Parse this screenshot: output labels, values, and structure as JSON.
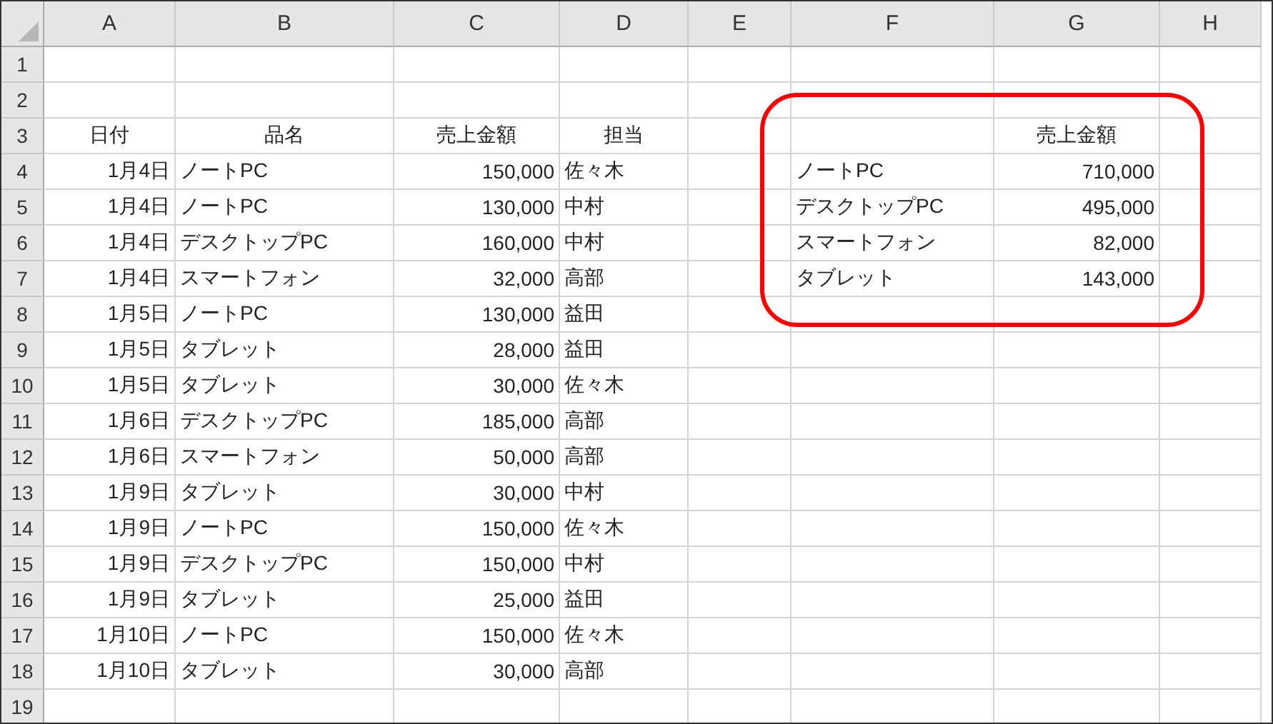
{
  "columns": [
    "A",
    "B",
    "C",
    "D",
    "E",
    "F",
    "G",
    "H"
  ],
  "rows": [
    {
      "number": "1",
      "kind": "data",
      "cells": {}
    },
    {
      "number": "2",
      "kind": "data",
      "cells": {}
    },
    {
      "number": "3",
      "kind": "header",
      "cells": {
        "A": "日付",
        "B": "品名",
        "C": "売上金額",
        "D": "担当",
        "G": "売上金額"
      }
    },
    {
      "number": "4",
      "kind": "data",
      "cells": {
        "A": "1月4日",
        "B": "ノートPC",
        "C": "150,000",
        "D": "佐々木",
        "F": "ノートPC",
        "G": "710,000"
      }
    },
    {
      "number": "5",
      "kind": "data",
      "cells": {
        "A": "1月4日",
        "B": "ノートPC",
        "C": "130,000",
        "D": "中村",
        "F": "デスクトップPC",
        "G": "495,000"
      }
    },
    {
      "number": "6",
      "kind": "data",
      "cells": {
        "A": "1月4日",
        "B": "デスクトップPC",
        "C": "160,000",
        "D": "中村",
        "F": "スマートフォン",
        "G": "82,000"
      }
    },
    {
      "number": "7",
      "kind": "data",
      "cells": {
        "A": "1月4日",
        "B": "スマートフォン",
        "C": "32,000",
        "D": "高部",
        "F": "タブレット",
        "G": "143,000"
      }
    },
    {
      "number": "8",
      "kind": "data",
      "cells": {
        "A": "1月5日",
        "B": "ノートPC",
        "C": "130,000",
        "D": "益田"
      }
    },
    {
      "number": "9",
      "kind": "data",
      "cells": {
        "A": "1月5日",
        "B": "タブレット",
        "C": "28,000",
        "D": "益田"
      }
    },
    {
      "number": "10",
      "kind": "data",
      "cells": {
        "A": "1月5日",
        "B": "タブレット",
        "C": "30,000",
        "D": "佐々木"
      }
    },
    {
      "number": "11",
      "kind": "data",
      "cells": {
        "A": "1月6日",
        "B": "デスクトップPC",
        "C": "185,000",
        "D": "高部"
      }
    },
    {
      "number": "12",
      "kind": "data",
      "cells": {
        "A": "1月6日",
        "B": "スマートフォン",
        "C": "50,000",
        "D": "高部"
      }
    },
    {
      "number": "13",
      "kind": "data",
      "cells": {
        "A": "1月9日",
        "B": "タブレット",
        "C": "30,000",
        "D": "中村"
      }
    },
    {
      "number": "14",
      "kind": "data",
      "cells": {
        "A": "1月9日",
        "B": "ノートPC",
        "C": "150,000",
        "D": "佐々木"
      }
    },
    {
      "number": "15",
      "kind": "data",
      "cells": {
        "A": "1月9日",
        "B": "デスクトップPC",
        "C": "150,000",
        "D": "中村"
      }
    },
    {
      "number": "16",
      "kind": "data",
      "cells": {
        "A": "1月9日",
        "B": "タブレット",
        "C": "25,000",
        "D": "益田"
      }
    },
    {
      "number": "17",
      "kind": "data",
      "cells": {
        "A": "1月10日",
        "B": "ノートPC",
        "C": "150,000",
        "D": "佐々木"
      }
    },
    {
      "number": "18",
      "kind": "data",
      "cells": {
        "A": "1月10日",
        "B": "タブレット",
        "C": "30,000",
        "D": "高部"
      }
    },
    {
      "number": "19",
      "kind": "data",
      "cells": {}
    }
  ]
}
